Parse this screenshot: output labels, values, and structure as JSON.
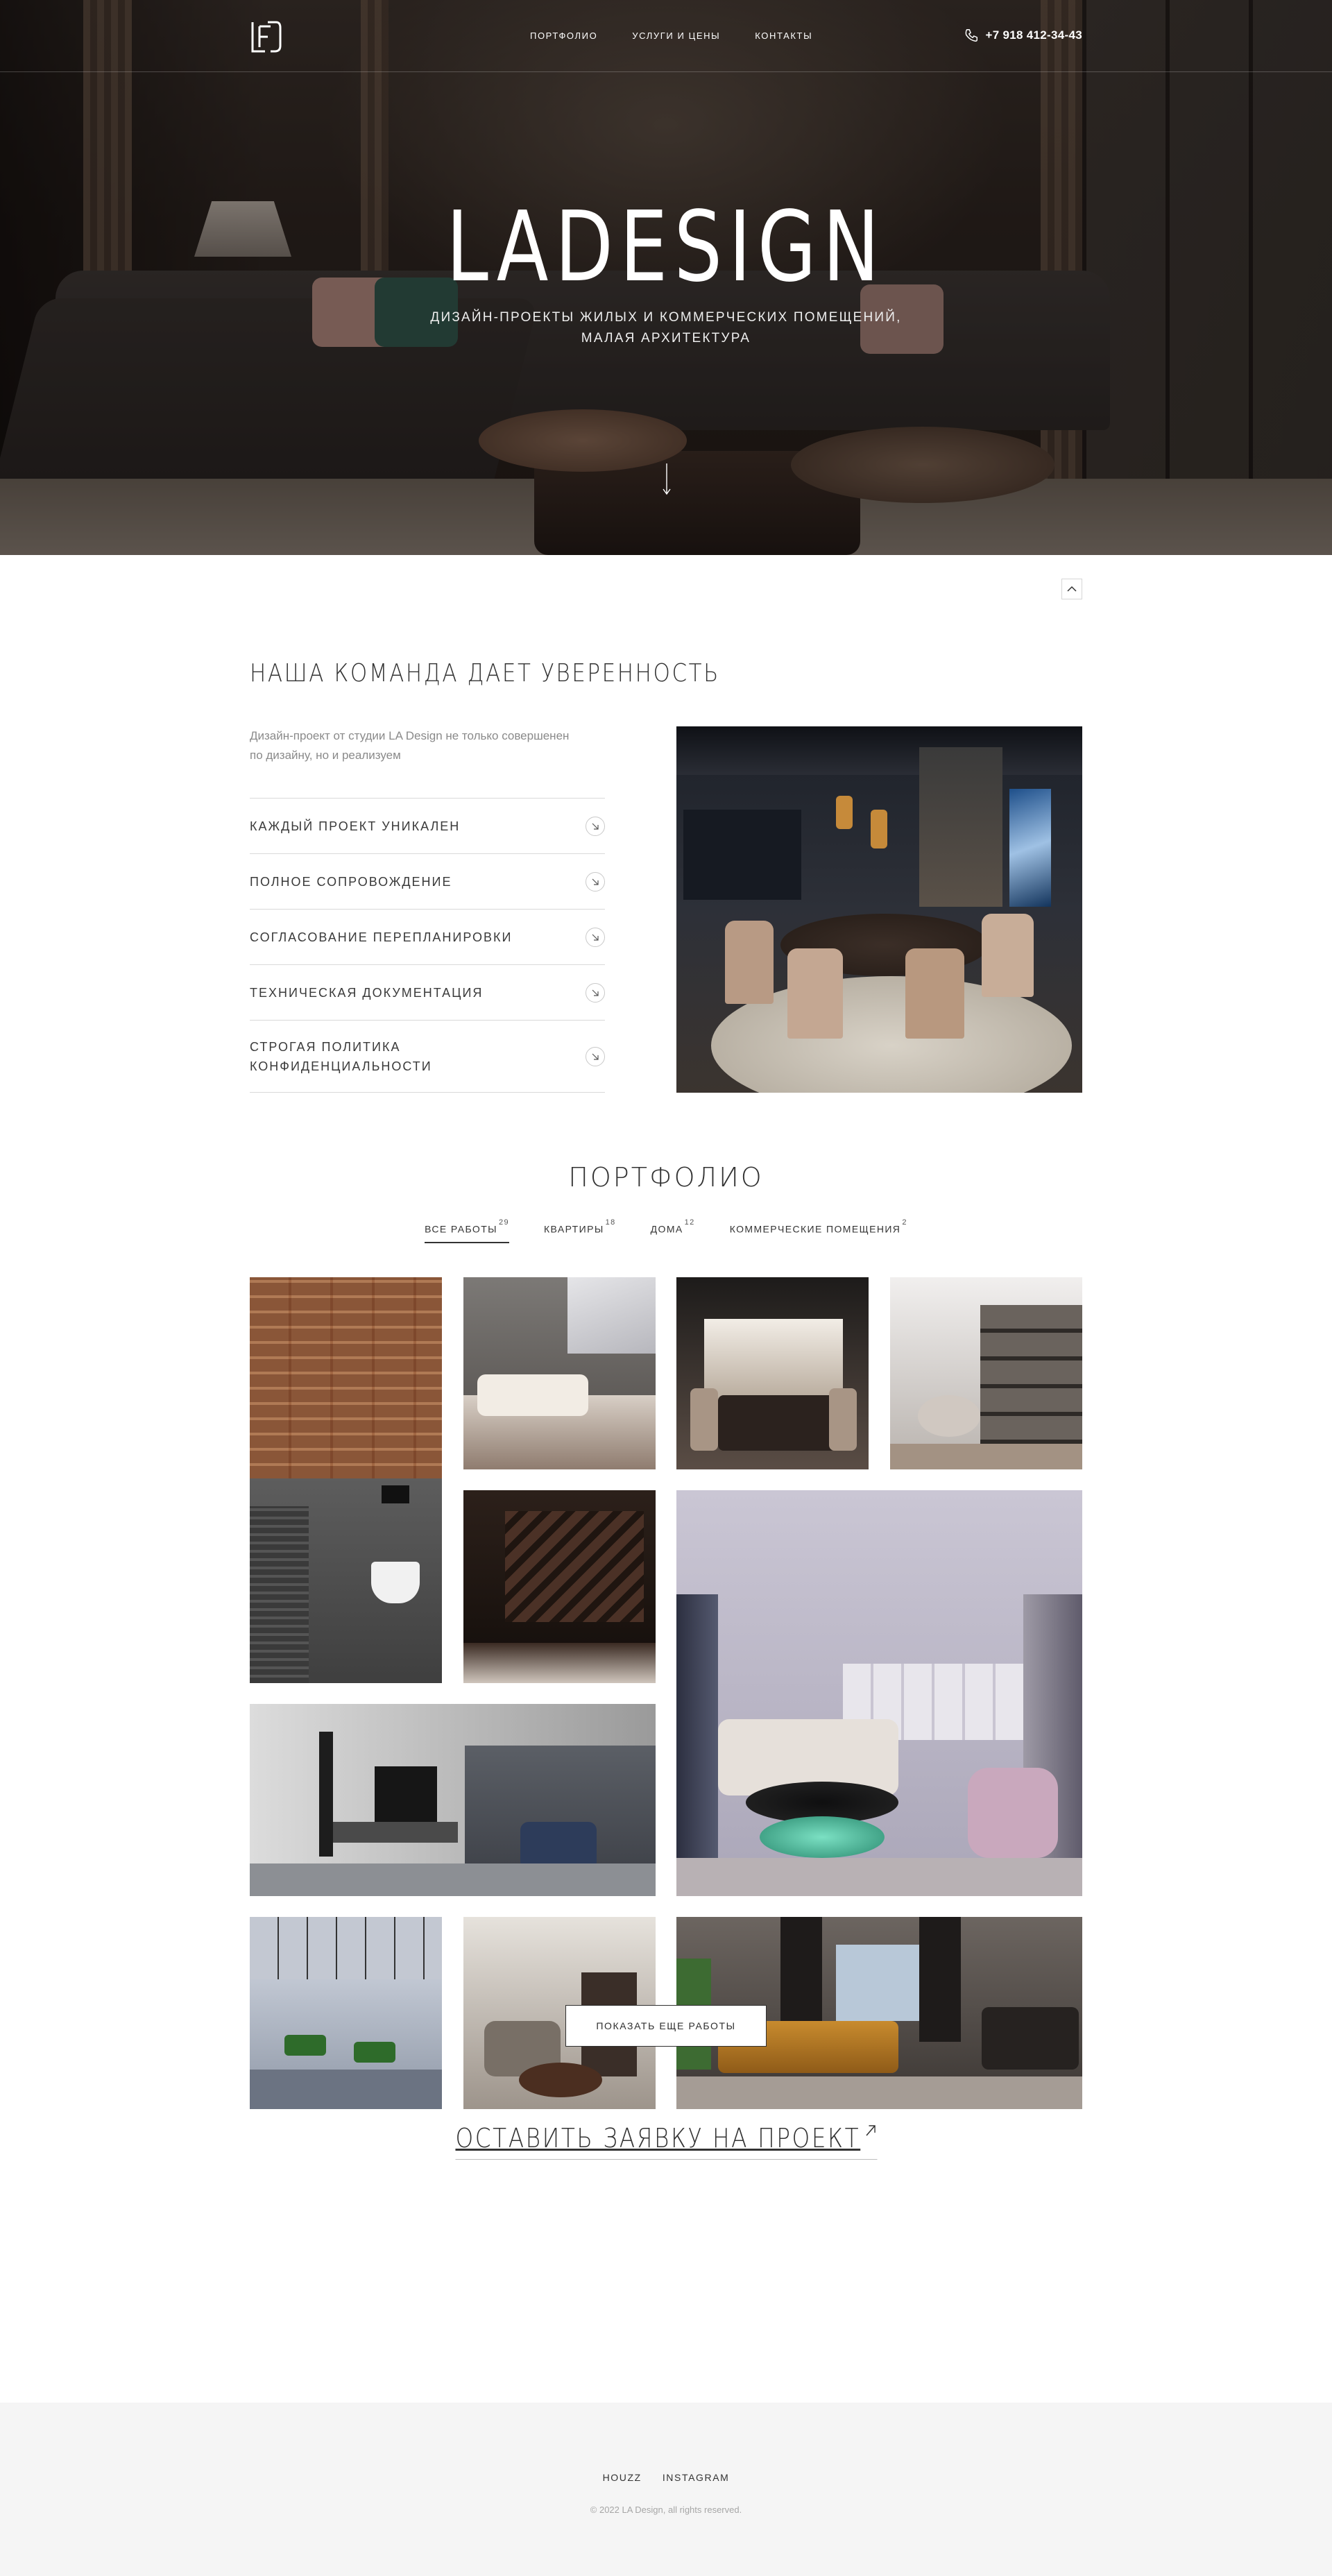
{
  "header": {
    "nav": [
      "ПОРТФОЛИО",
      "УСЛУГИ И ЦЕНЫ",
      "КОНТАКТЫ"
    ],
    "phone": "+7 918 412-34-43"
  },
  "hero": {
    "title": "LADESIGN",
    "subtitle_line1": "ДИЗАЙН-ПРОЕКТЫ ЖИЛЫХ И КОММЕРЧЕСКИХ ПОМЕЩЕНИЙ,",
    "subtitle_line2": "МАЛАЯ АРХИТЕКТУРА"
  },
  "team": {
    "title": "НАША КОМАНДА ДАЕТ УВЕРЕННОСТЬ",
    "lead_line1": "Дизайн-проект от студии LA Design не только совершенен",
    "lead_line2": "по дизайну, но и реализуем",
    "features": [
      "КАЖДЫЙ ПРОЕКТ УНИКАЛЕН",
      "ПОЛНОЕ СОПРОВОЖДЕНИЕ",
      "СОГЛАСОВАНИЕ ПЕРЕПЛАНИРОВКИ",
      "ТЕХНИЧЕСКАЯ ДОКУМЕНТАЦИЯ",
      "СТРОГАЯ ПОЛИТИКА КОНФИДЕНЦИАЛЬНОСТИ"
    ]
  },
  "portfolio": {
    "title": "ПОРТФОЛИО",
    "tabs": [
      {
        "label": "ВСЕ РАБОТЫ",
        "count": "29"
      },
      {
        "label": "КВАРТИРЫ",
        "count": "18"
      },
      {
        "label": "ДОМА",
        "count": "12"
      },
      {
        "label": "КОММЕРЧЕСКИЕ ПОМЕЩЕНИЯ",
        "count": "2"
      }
    ],
    "more_button": "ПОКАЗАТЬ ЕЩЕ РАБОТЫ"
  },
  "cta": "ОСТАВИТЬ ЗАЯВКУ НА ПРОЕКТ",
  "footer": {
    "links": [
      "HOUZZ",
      "INSTAGRAM"
    ],
    "copyright": "© 2022 LA Design, all rights reserved."
  },
  "colors": {
    "text": "#333333",
    "muted": "#8a8a8a",
    "footer_bg": "#f5f5f5"
  },
  "icons": [
    "logo-icon",
    "phone-icon",
    "arrow-down-icon",
    "chevron-up-icon",
    "arrow-down-right-icon",
    "arrow-up-right-icon"
  ]
}
